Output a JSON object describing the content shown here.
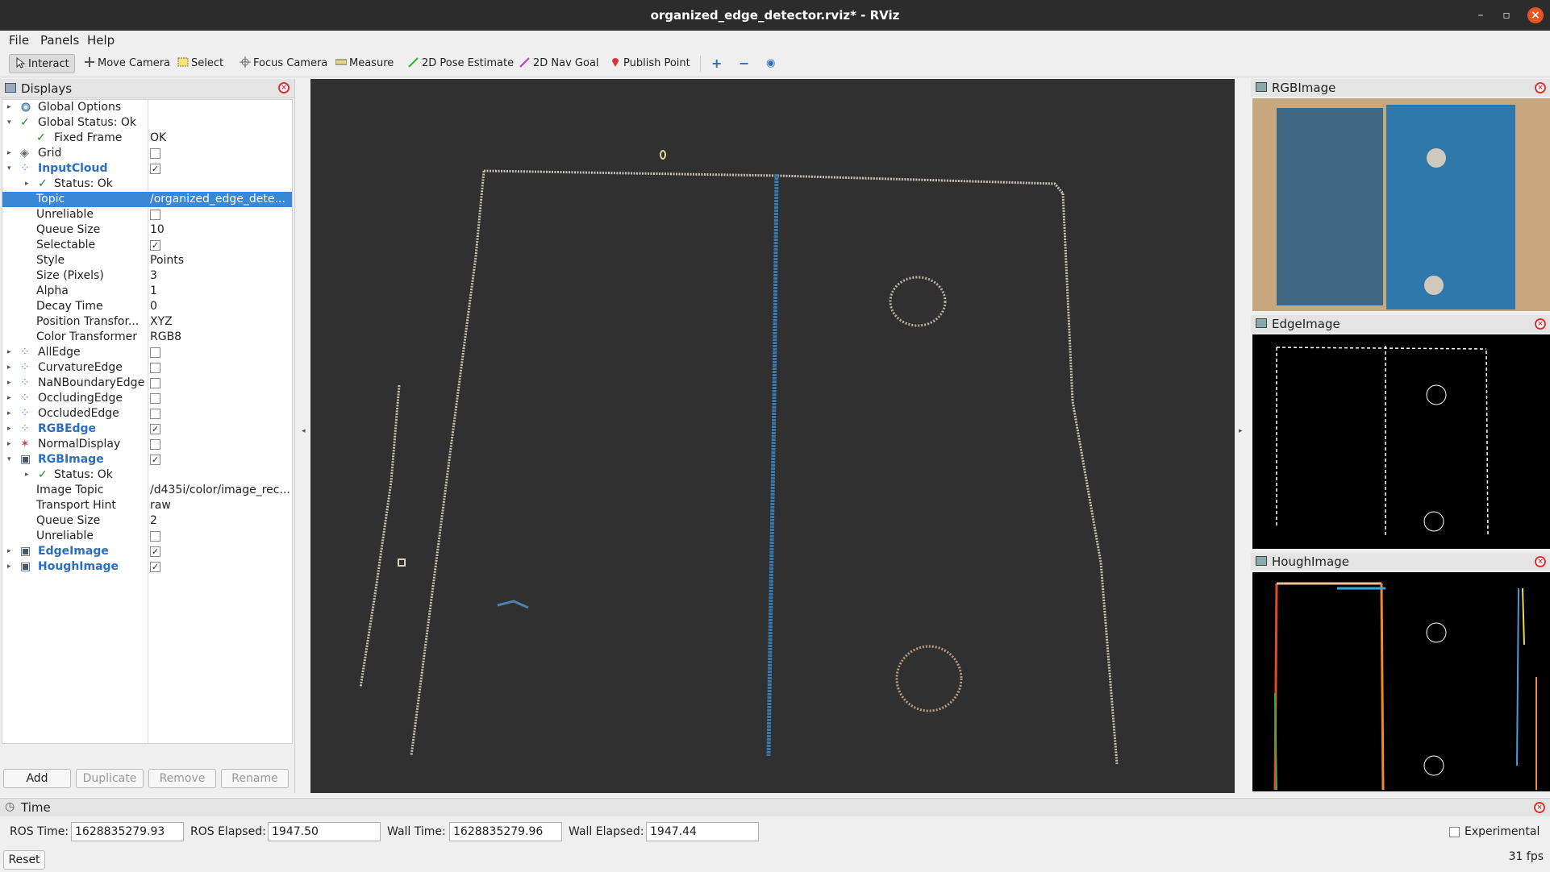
{
  "window": {
    "title": "organized_edge_detector.rviz* - RViz"
  },
  "menu": [
    "File",
    "Panels",
    "Help"
  ],
  "toolbar": {
    "interact": "Interact",
    "move_camera": "Move Camera",
    "select": "Select",
    "focus_camera": "Focus Camera",
    "measure": "Measure",
    "pose_estimate": "2D Pose Estimate",
    "nav_goal": "2D Nav Goal",
    "publish_point": "Publish Point"
  },
  "displays": {
    "title": "Displays",
    "rows": [
      {
        "label": "Global Options",
        "value": ""
      },
      {
        "label": "Global Status: Ok",
        "value": ""
      },
      {
        "label": "Fixed Frame",
        "value": "OK"
      },
      {
        "label": "Grid",
        "value": ""
      },
      {
        "label": "InputCloud",
        "value": ""
      },
      {
        "label": "Status: Ok",
        "value": ""
      },
      {
        "label": "Topic",
        "value": "/organized_edge_dete..."
      },
      {
        "label": "Unreliable",
        "value": ""
      },
      {
        "label": "Queue Size",
        "value": "10"
      },
      {
        "label": "Selectable",
        "value": ""
      },
      {
        "label": "Style",
        "value": "Points"
      },
      {
        "label": "Size (Pixels)",
        "value": "3"
      },
      {
        "label": "Alpha",
        "value": "1"
      },
      {
        "label": "Decay Time",
        "value": "0"
      },
      {
        "label": "Position Transfor...",
        "value": "XYZ"
      },
      {
        "label": "Color Transformer",
        "value": "RGB8"
      },
      {
        "label": "AllEdge",
        "value": ""
      },
      {
        "label": "CurvatureEdge",
        "value": ""
      },
      {
        "label": "NaNBoundaryEdge",
        "value": ""
      },
      {
        "label": "OccludingEdge",
        "value": ""
      },
      {
        "label": "OccludedEdge",
        "value": ""
      },
      {
        "label": "RGBEdge",
        "value": ""
      },
      {
        "label": "NormalDisplay",
        "value": ""
      },
      {
        "label": "RGBImage",
        "value": ""
      },
      {
        "label": "Status: Ok",
        "value": ""
      },
      {
        "label": "Image Topic",
        "value": "/d435i/color/image_rec..."
      },
      {
        "label": "Transport Hint",
        "value": "raw"
      },
      {
        "label": "Queue Size",
        "value": "2"
      },
      {
        "label": "Unreliable",
        "value": ""
      },
      {
        "label": "EdgeImage",
        "value": ""
      },
      {
        "label": "HoughImage",
        "value": ""
      }
    ],
    "buttons": {
      "add": "Add",
      "duplicate": "Duplicate",
      "remove": "Remove",
      "rename": "Rename"
    }
  },
  "panels": {
    "rgb": "RGBImage",
    "edge": "EdgeImage",
    "hough": "HoughImage"
  },
  "time": {
    "title": "Time",
    "ros_time_label": "ROS Time:",
    "ros_time": "1628835279.93",
    "ros_elapsed_label": "ROS Elapsed:",
    "ros_elapsed": "1947.50",
    "wall_time_label": "Wall Time:",
    "wall_time": "1628835279.96",
    "wall_elapsed_label": "Wall Elapsed:",
    "wall_elapsed": "1947.44",
    "experimental": "Experimental",
    "reset": "Reset",
    "fps": "31 fps"
  }
}
